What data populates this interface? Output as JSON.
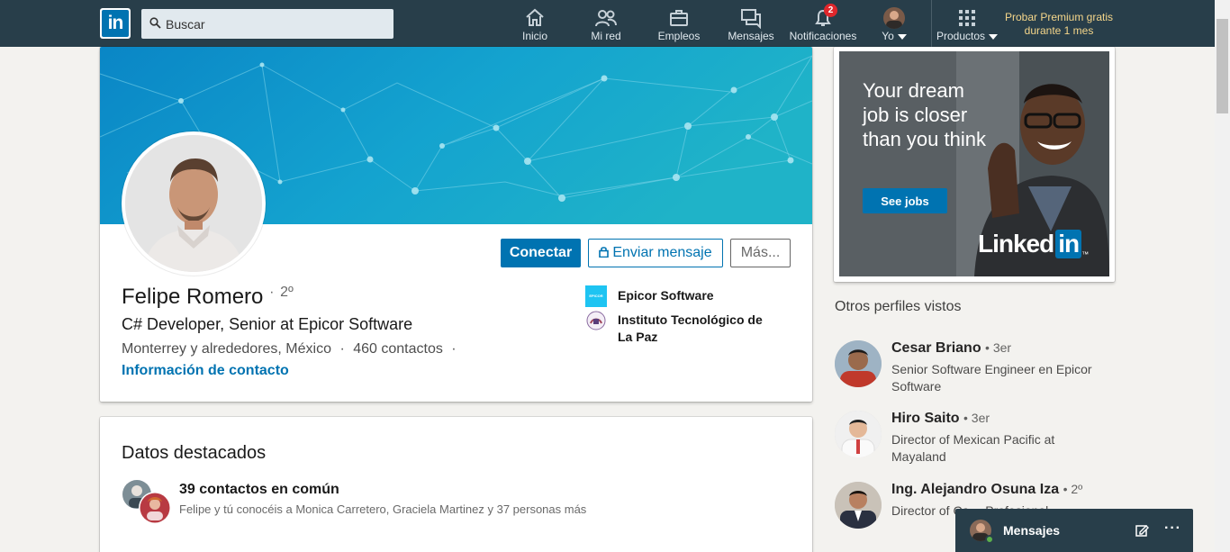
{
  "nav": {
    "logo_text": "in",
    "search_placeholder": "Buscar",
    "items": [
      {
        "label": "Inicio",
        "icon": "home-icon"
      },
      {
        "label": "Mi red",
        "icon": "network-icon"
      },
      {
        "label": "Empleos",
        "icon": "briefcase-icon"
      },
      {
        "label": "Mensajes",
        "icon": "messages-icon"
      },
      {
        "label": "Notificaciones",
        "icon": "bell-icon",
        "badge": "2"
      },
      {
        "label": "Yo",
        "icon": "avatar"
      },
      {
        "label": "Productos",
        "icon": "grid-icon"
      }
    ],
    "premium_line1": "Probar Premium gratis",
    "premium_line2": "durante 1 mes"
  },
  "profile": {
    "name": "Felipe Romero",
    "degree_sep": "·",
    "degree": "2º",
    "headline": "C# Developer, Senior at Epicor Software",
    "location": "Monterrey y alrededores, México",
    "sep": "·",
    "connections": "460 contactos",
    "sep2": "·",
    "contact_info": "Información de contacto",
    "buttons": {
      "connect": "Conectar",
      "message": "Enviar mensaje",
      "more": "Más..."
    },
    "orgs": [
      {
        "name": "Epicor Software",
        "logo_text": "EPICOR"
      },
      {
        "name": "Instituto Tecnológico de La Paz"
      }
    ]
  },
  "highlights": {
    "title": "Datos destacados",
    "count": "39 contactos en común",
    "desc": "Felipe y tú conocéis a Monica Carretero, Graciela Martinez y 37 personas más"
  },
  "ad": {
    "headline": "Your dream job is closer than you think",
    "button": "See jobs",
    "brand": "Linked",
    "brand_in": "in",
    "brand_tm": "™"
  },
  "others": {
    "title": "Otros perfiles vistos",
    "people": [
      {
        "name": "Cesar Briano",
        "degree": "• 3er",
        "title": "Senior Software Engineer en Epicor Software"
      },
      {
        "name": "Hiro Saito",
        "degree": "• 3er",
        "title": "Director of Mexican Pacific at Mayaland"
      },
      {
        "name": "Ing. Alejandro Osuna Iza",
        "degree": "• 2º",
        "title": "Director of Ca… Profesional…"
      }
    ]
  },
  "messaging": {
    "label": "Mensajes",
    "more": "···"
  }
}
